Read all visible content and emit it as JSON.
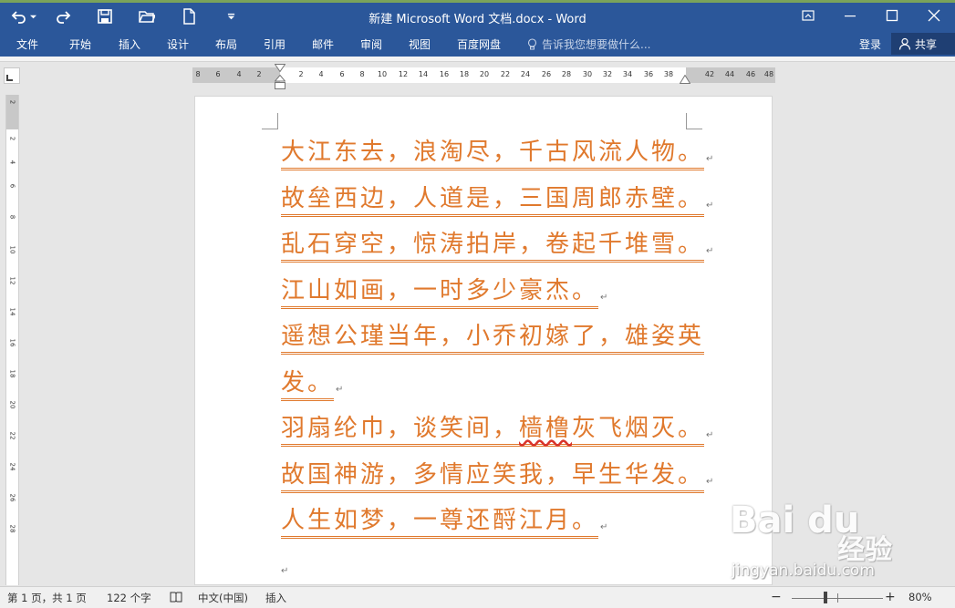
{
  "window": {
    "title": "新建 Microsoft Word 文档.docx - Word",
    "accent_color": "#2b579a"
  },
  "quick_access": [
    {
      "name": "undo-icon"
    },
    {
      "name": "redo-icon"
    },
    {
      "name": "save-icon"
    },
    {
      "name": "open-folder-icon"
    },
    {
      "name": "new-document-icon"
    },
    {
      "name": "customize-qat-icon"
    }
  ],
  "ribbon_tabs": [
    "文件",
    "开始",
    "插入",
    "设计",
    "布局",
    "引用",
    "邮件",
    "审阅",
    "视图",
    "百度网盘"
  ],
  "tell_me": {
    "placeholder": "告诉我您想要做什么..."
  },
  "account": {
    "login_label": "登录",
    "share_label": "共享"
  },
  "ruler": {
    "horizontal_ticks": [
      "8",
      "6",
      "4",
      "2",
      "2",
      "4",
      "6",
      "8",
      "10",
      "12",
      "14",
      "16",
      "18",
      "20",
      "22",
      "24",
      "26",
      "28",
      "30",
      "32",
      "34",
      "36",
      "38",
      "42",
      "44",
      "46",
      "48"
    ],
    "vertical_ticks": [
      "2",
      "2",
      "4",
      "6",
      "8",
      "10",
      "12",
      "14",
      "16",
      "18",
      "20",
      "22",
      "24",
      "26",
      "28"
    ]
  },
  "document": {
    "text_color": "#e0792d",
    "lines": [
      "大江东去，浪淘尽，千古风流人物。",
      "故垒西边，人道是，三国周郎赤壁。",
      "乱石穿空，惊涛拍岸，卷起千堆雪。",
      "江山如画，一时多少豪杰。",
      "遥想公瑾当年，小乔初嫁了，雄姿英",
      "发。",
      "羽扇纶巾，谈笑间，",
      "故国神游，多情应笑我，早生华发。",
      "人生如梦，一尊还酹江月。"
    ],
    "line7_misspelled": "樯橹",
    "line7_rest": "灰飞烟灭。",
    "paragraph_mark": "↵"
  },
  "status_bar": {
    "page": "第 1 页，共 1 页",
    "word_count": "122 个字",
    "language": "中文(中国)",
    "mode": "插入",
    "zoom_minus": "−",
    "zoom_plus": "+",
    "zoom_percent": "80%",
    "zoom_value_percent": 80
  },
  "watermark": {
    "logo": "Bai du",
    "brand": "经验",
    "url": "jingyan.baidu.com"
  }
}
